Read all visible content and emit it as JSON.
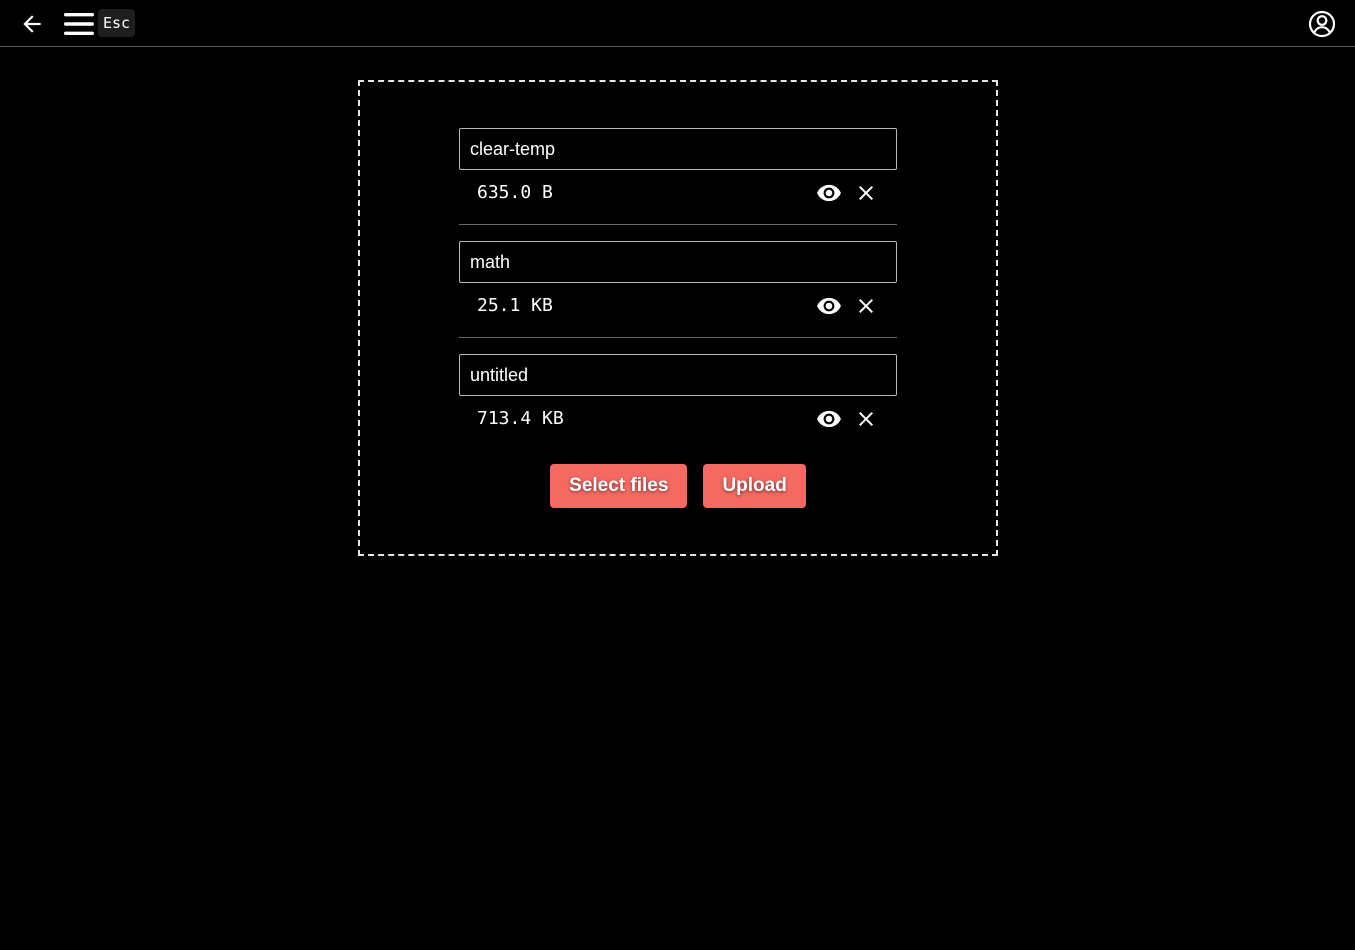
{
  "header": {
    "back_icon": "arrow-left-icon",
    "menu_icon": "hamburger-menu-icon",
    "esc_hint": "Esc",
    "account_icon": "account-circle-icon"
  },
  "files": [
    {
      "name": "clear-temp",
      "size": "635.0 B"
    },
    {
      "name": "math",
      "size": "25.1 KB"
    },
    {
      "name": "untitled",
      "size": "713.4 KB"
    }
  ],
  "file_actions": {
    "view_icon": "eye-icon",
    "remove_icon": "close-icon"
  },
  "actions": {
    "select_label": "Select files",
    "upload_label": "Upload"
  },
  "colors": {
    "background": "#000000",
    "accent": "#f46a62",
    "text": "#ffffff",
    "dropzone_border": "#e6e6e6"
  }
}
